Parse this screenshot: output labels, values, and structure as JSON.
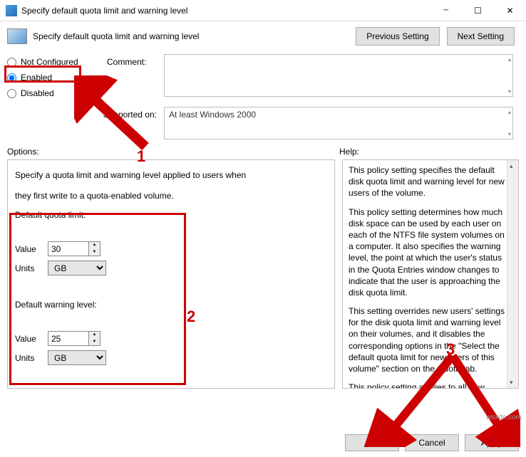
{
  "window": {
    "title": "Specify default quota limit and warning level",
    "subtitle": "Specify default quota limit and warning level",
    "prev_btn": "Previous Setting",
    "next_btn": "Next Setting"
  },
  "state": {
    "not_configured": "Not Configured",
    "enabled": "Enabled",
    "disabled": "Disabled",
    "comment_label": "Comment:",
    "comment_value": "",
    "supported_label": "Supported on:",
    "supported_value": "At least Windows 2000"
  },
  "labels": {
    "options": "Options:",
    "help": "Help:"
  },
  "options": {
    "desc1": "Specify a quota limit and warning level applied to users when",
    "desc2": "they first write to a quota-enabled volume.",
    "default_quota_label": "Default quota limit:",
    "value_label": "Value",
    "units_label": "Units",
    "quota_value": "30",
    "quota_units": "GB",
    "default_warning_label": "Default warning level:",
    "warning_value": "25",
    "warning_units": "GB"
  },
  "help": {
    "p1": "This policy setting specifies the default disk quota limit and warning level for new users of the volume.",
    "p2": "This policy setting determines how much disk space can be used by each user on each of the NTFS file system volumes on a computer. It also specifies the warning level, the point at which the user's status in the Quota Entries window changes to indicate that the user is approaching the disk quota limit.",
    "p3": "This setting overrides new users' settings for the disk quota limit and warning level on their volumes, and it disables the corresponding options in the \"Select the default quota limit for new users of this volume\" section on the Quota tab.",
    "p4": "This policy setting applies to all new users as soon as they write to the volume. It does"
  },
  "footer": {
    "ok": "OK",
    "cancel": "Cancel",
    "apply": "Apply"
  },
  "annotations": {
    "n1": "1",
    "n2": "2",
    "n3": "3"
  },
  "watermark": "wsxdn.com"
}
